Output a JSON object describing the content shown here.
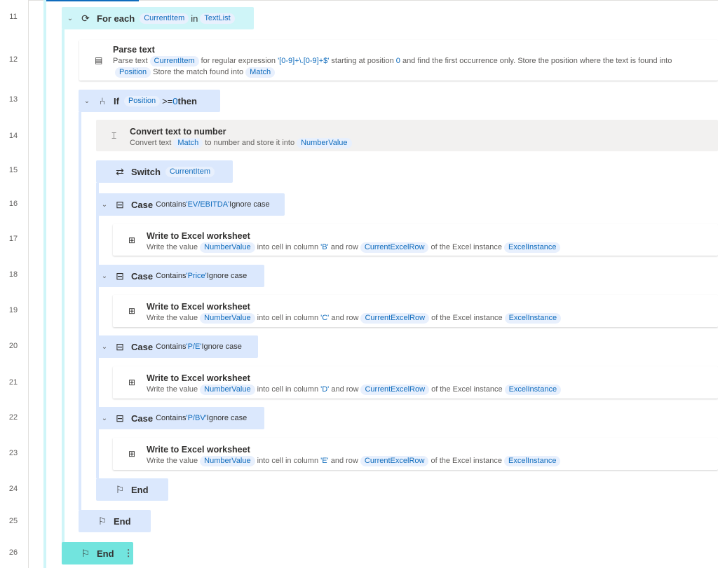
{
  "line_numbers": [
    "11",
    "12",
    "13",
    "14",
    "15",
    "16",
    "17",
    "18",
    "19",
    "20",
    "21",
    "22",
    "23",
    "24",
    "25",
    "26"
  ],
  "colors": {
    "loop": "#cff5f8",
    "loop_end_selected": "#72e4de",
    "loop_bar": "#cff5f8",
    "condition": "#dbe8fd",
    "selected_action": "#f2f1f0",
    "variable_text": "#0f6cbd"
  },
  "steps": [
    {
      "type": "header",
      "icon": "loop-icon",
      "glyph": "⟳",
      "chevron": true,
      "title": "For each",
      "parts": [
        {
          "t": "CurrentItem",
          "k": "var"
        },
        {
          "t": "in",
          "k": "plain"
        },
        {
          "t": "TextList",
          "k": "var"
        }
      ]
    },
    {
      "type": "card",
      "icon": "parse-text-icon",
      "glyph": "▤",
      "title": "Parse text",
      "parts": [
        {
          "t": "Parse text",
          "k": "plain"
        },
        {
          "t": "CurrentItem",
          "k": "var"
        },
        {
          "t": "for regular expression ",
          "k": "plain"
        },
        {
          "t": "'[0-9]+\\.[0-9]+$'",
          "k": "lit"
        },
        {
          "t": " starting at position ",
          "k": "plain"
        },
        {
          "t": "0",
          "k": "lit"
        },
        {
          "t": " and find the first occurrence only. Store the position where the text is found into",
          "k": "plain"
        },
        {
          "t": "Position",
          "k": "var"
        },
        {
          "t": "Store the match found into",
          "k": "plain"
        },
        {
          "t": "Match",
          "k": "var"
        }
      ]
    },
    {
      "type": "header",
      "icon": "if-icon",
      "glyph": "⑃",
      "chevron": true,
      "title": "If",
      "parts": [
        {
          "t": "Position",
          "k": "var"
        },
        {
          "t": ">=",
          "k": "plain"
        },
        {
          "t": "0",
          "k": "lit"
        },
        {
          "t": " then",
          "k": "bold"
        }
      ]
    },
    {
      "type": "card",
      "icon": "convert-number-icon",
      "glyph": "⌶",
      "title": "Convert text to number",
      "parts": [
        {
          "t": "Convert text",
          "k": "plain"
        },
        {
          "t": "Match",
          "k": "var"
        },
        {
          "t": "to number and store it into",
          "k": "plain"
        },
        {
          "t": "NumberValue",
          "k": "var"
        }
      ]
    },
    {
      "type": "header",
      "icon": "switch-icon",
      "glyph": "⇄",
      "chevron": false,
      "title": "Switch",
      "parts": [
        {
          "t": "CurrentItem",
          "k": "var"
        }
      ]
    },
    {
      "type": "header",
      "icon": "case-icon",
      "glyph": "⊟",
      "chevron": true,
      "title": "Case",
      "parts": [
        {
          "t": "Contains",
          "k": "sm"
        },
        {
          "t": "'EV/EBITDA'",
          "k": "litsm"
        },
        {
          "t": "Ignore case",
          "k": "sm"
        }
      ]
    },
    {
      "type": "card",
      "icon": "excel-icon",
      "glyph": "⊞",
      "title": "Write to Excel worksheet",
      "parts": [
        {
          "t": "Write the value",
          "k": "plain"
        },
        {
          "t": "NumberValue",
          "k": "var"
        },
        {
          "t": "into cell in column ",
          "k": "plain"
        },
        {
          "t": "'B'",
          "k": "lit"
        },
        {
          "t": " and row",
          "k": "plain"
        },
        {
          "t": "CurrentExcelRow",
          "k": "var"
        },
        {
          "t": "of the Excel instance",
          "k": "plain"
        },
        {
          "t": "ExcelInstance",
          "k": "var"
        }
      ]
    },
    {
      "type": "header",
      "icon": "case-icon",
      "glyph": "⊟",
      "chevron": true,
      "title": "Case",
      "parts": [
        {
          "t": "Contains",
          "k": "sm"
        },
        {
          "t": "'Price'",
          "k": "litsm"
        },
        {
          "t": "Ignore case",
          "k": "sm"
        }
      ]
    },
    {
      "type": "card",
      "icon": "excel-icon",
      "glyph": "⊞",
      "title": "Write to Excel worksheet",
      "parts": [
        {
          "t": "Write the value",
          "k": "plain"
        },
        {
          "t": "NumberValue",
          "k": "var"
        },
        {
          "t": "into cell in column ",
          "k": "plain"
        },
        {
          "t": "'C'",
          "k": "lit"
        },
        {
          "t": " and row",
          "k": "plain"
        },
        {
          "t": "CurrentExcelRow",
          "k": "var"
        },
        {
          "t": "of the Excel instance",
          "k": "plain"
        },
        {
          "t": "ExcelInstance",
          "k": "var"
        }
      ]
    },
    {
      "type": "header",
      "icon": "case-icon",
      "glyph": "⊟",
      "chevron": true,
      "title": "Case",
      "parts": [
        {
          "t": "Contains",
          "k": "sm"
        },
        {
          "t": "'P/E'",
          "k": "litsm"
        },
        {
          "t": "Ignore case",
          "k": "sm"
        }
      ]
    },
    {
      "type": "card",
      "icon": "excel-icon",
      "glyph": "⊞",
      "title": "Write to Excel worksheet",
      "parts": [
        {
          "t": "Write the value",
          "k": "plain"
        },
        {
          "t": "NumberValue",
          "k": "var"
        },
        {
          "t": "into cell in column ",
          "k": "plain"
        },
        {
          "t": "'D'",
          "k": "lit"
        },
        {
          "t": " and row",
          "k": "plain"
        },
        {
          "t": "CurrentExcelRow",
          "k": "var"
        },
        {
          "t": "of the Excel instance",
          "k": "plain"
        },
        {
          "t": "ExcelInstance",
          "k": "var"
        }
      ]
    },
    {
      "type": "header",
      "icon": "case-icon",
      "glyph": "⊟",
      "chevron": true,
      "title": "Case",
      "parts": [
        {
          "t": "Contains",
          "k": "sm"
        },
        {
          "t": "'P/BV'",
          "k": "litsm"
        },
        {
          "t": "Ignore case",
          "k": "sm"
        }
      ]
    },
    {
      "type": "card",
      "icon": "excel-icon",
      "glyph": "⊞",
      "title": "Write to Excel worksheet",
      "parts": [
        {
          "t": "Write the value",
          "k": "plain"
        },
        {
          "t": "NumberValue",
          "k": "var"
        },
        {
          "t": "into cell in column ",
          "k": "plain"
        },
        {
          "t": "'E'",
          "k": "lit"
        },
        {
          "t": " and row",
          "k": "plain"
        },
        {
          "t": "CurrentExcelRow",
          "k": "var"
        },
        {
          "t": "of the Excel instance",
          "k": "plain"
        },
        {
          "t": "ExcelInstance",
          "k": "var"
        }
      ]
    },
    {
      "type": "header",
      "icon": "end-flag-icon",
      "glyph": "⚐",
      "chevron": false,
      "title": "End",
      "parts": []
    },
    {
      "type": "header",
      "icon": "end-flag-icon",
      "glyph": "⚐",
      "chevron": false,
      "title": "End",
      "parts": []
    },
    {
      "type": "header",
      "icon": "end-flag-icon",
      "glyph": "⚐",
      "chevron": false,
      "title": "End",
      "parts": [],
      "more_menu": "⋮"
    }
  ]
}
